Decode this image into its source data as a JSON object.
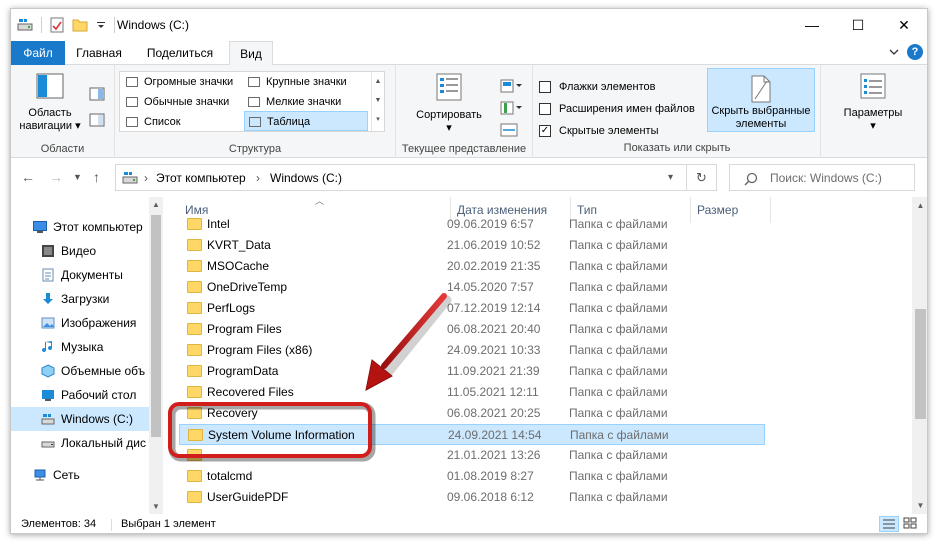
{
  "window": {
    "title": "Windows (C:)",
    "controls": [
      "—",
      "☐",
      "✕"
    ]
  },
  "tabs": {
    "file": "Файл",
    "home": "Главная",
    "share": "Поделиться",
    "view": "Вид",
    "help": "?"
  },
  "ribbon": {
    "panes": {
      "nav_pane_line1": "Область",
      "nav_pane_line2": "навигации",
      "label": "Области"
    },
    "layout": {
      "items": [
        "Огромные значки",
        "Крупные значки",
        "Обычные значки",
        "Мелкие значки",
        "Список",
        "Таблица"
      ],
      "selected": "Таблица",
      "label": "Структура"
    },
    "current_view": {
      "sort": "Сортировать",
      "label": "Текущее представление"
    },
    "show_hide": {
      "item_checkboxes": "Флажки элементов",
      "file_extensions": "Расширения имен файлов",
      "hidden_items": "Скрытые элементы",
      "item_checkboxes_checked": false,
      "file_extensions_checked": false,
      "hidden_items_checked": true,
      "hide_selected_line1": "Скрыть выбранные",
      "hide_selected_line2": "элементы",
      "label": "Показать или скрыть"
    },
    "options": {
      "label": "Параметры"
    }
  },
  "address": {
    "crumbs": [
      "Этот компьютер",
      "Windows (C:)"
    ],
    "search_placeholder": "Поиск: Windows (C:)"
  },
  "nav_pane": {
    "items": [
      {
        "label": "Этот компьютер",
        "icon": "computer-icon"
      },
      {
        "label": "Видео",
        "icon": "video-icon"
      },
      {
        "label": "Документы",
        "icon": "documents-icon"
      },
      {
        "label": "Загрузки",
        "icon": "downloads-icon"
      },
      {
        "label": "Изображения",
        "icon": "pictures-icon"
      },
      {
        "label": "Музыка",
        "icon": "music-icon"
      },
      {
        "label": "Объемные объ",
        "icon": "3d-objects-icon"
      },
      {
        "label": "Рабочий стол",
        "icon": "desktop-icon"
      },
      {
        "label": "Windows (C:)",
        "icon": "drive-icon"
      },
      {
        "label": "Локальный дис",
        "icon": "drive-icon"
      },
      {
        "label": "Сеть",
        "icon": "network-icon"
      }
    ],
    "selected": "Windows (C:)"
  },
  "columns": {
    "name": "Имя",
    "date": "Дата изменения",
    "type": "Тип",
    "size": "Размер"
  },
  "files": [
    {
      "name": "Intel",
      "date": "09.06.2019 6:57",
      "type": "Папка с файлами"
    },
    {
      "name": "KVRT_Data",
      "date": "21.06.2019 10:52",
      "type": "Папка с файлами"
    },
    {
      "name": "MSOCache",
      "date": "20.02.2019 21:35",
      "type": "Папка с файлами"
    },
    {
      "name": "OneDriveTemp",
      "date": "14.05.2020 7:57",
      "type": "Папка с файлами"
    },
    {
      "name": "PerfLogs",
      "date": "07.12.2019 12:14",
      "type": "Папка с файлами"
    },
    {
      "name": "Program Files",
      "date": "06.08.2021 20:40",
      "type": "Папка с файлами"
    },
    {
      "name": "Program Files (x86)",
      "date": "24.09.2021 10:33",
      "type": "Папка с файлами"
    },
    {
      "name": "ProgramData",
      "date": "11.09.2021 21:39",
      "type": "Папка с файлами"
    },
    {
      "name": "Recovered Files",
      "date": "11.05.2021 12:11",
      "type": "Папка с файлами"
    },
    {
      "name": "Recovery",
      "date": "06.08.2021 20:25",
      "type": "Папка с файлами"
    },
    {
      "name": "System Volume Information",
      "date": "24.09.2021 14:54",
      "type": "Папка с файлами"
    },
    {
      "name": "",
      "date": "21.01.2021 13:26",
      "type": "Папка с файлами"
    },
    {
      "name": "totalcmd",
      "date": "01.08.2019 8:27",
      "type": "Папка с файлами"
    },
    {
      "name": "UserGuidePDF",
      "date": "09.06.2018 6:12",
      "type": "Папка с файлами"
    }
  ],
  "selected_file": "System Volume Information",
  "status": {
    "count": "Элементов: 34",
    "selected": "Выбран 1 элемент"
  },
  "colors": {
    "accent": "#1979ca",
    "selection": "#cce8ff",
    "annotation_red": "#d21d1d"
  }
}
